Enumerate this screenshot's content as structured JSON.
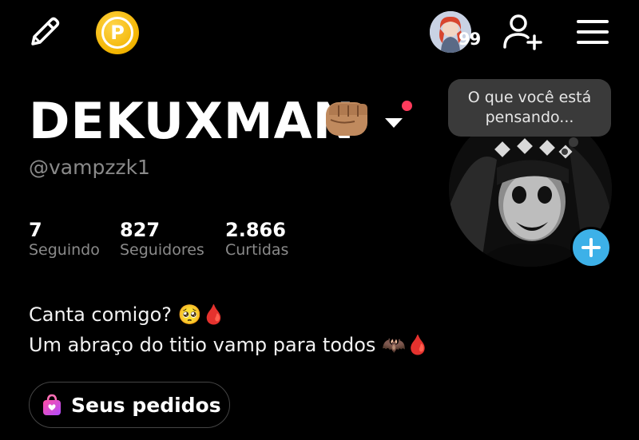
{
  "header": {
    "edit_icon": "pencil-icon",
    "coin_icon": "coin-icon",
    "coin_letter": "P",
    "notification_count": "99",
    "add_friend_icon": "add-user-icon",
    "menu_icon": "hamburger-menu-icon"
  },
  "profile": {
    "display_name": "DEKUXMAN",
    "name_emoji": "👊🏽",
    "handle": "@vampzzk1",
    "thought_bubble": "O que você está pensando...",
    "stats": [
      {
        "value": "7",
        "label": "Seguindo"
      },
      {
        "value": "827",
        "label": "Seguidores"
      },
      {
        "value": "2.866",
        "label": "Curtidas"
      }
    ],
    "bio_lines": [
      "Canta comigo? 🥺🩸",
      "Um abraço do titio vamp para todos 🦇🩸"
    ],
    "orders_label": "Seus pedidos"
  },
  "colors": {
    "background": "#000000",
    "muted_text": "#8a8a8a",
    "accent_blue": "#3db1e8",
    "coin_gold": "#f2b400",
    "notification_red": "#ff3b5c"
  }
}
